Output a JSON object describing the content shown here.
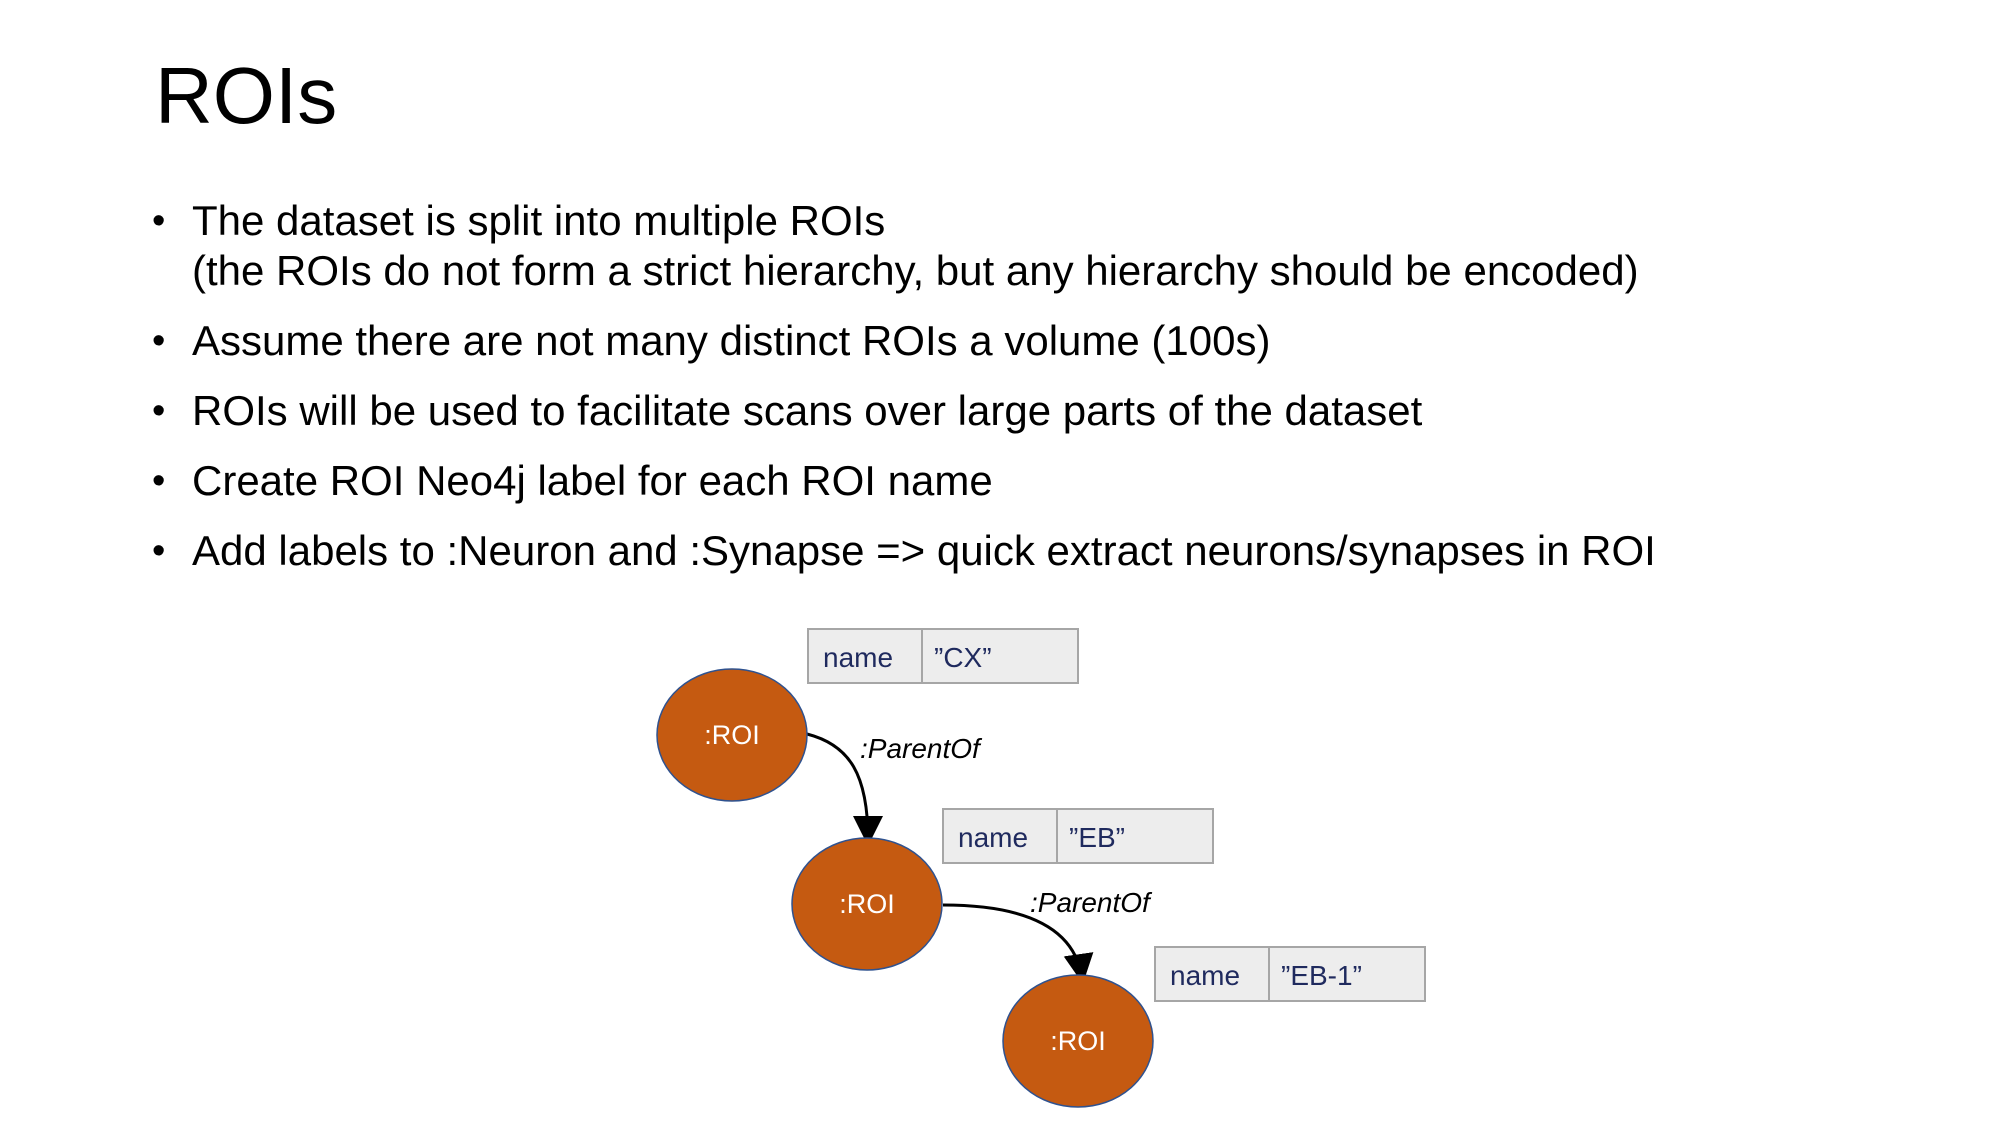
{
  "slide": {
    "title": "ROIs",
    "bullets": [
      {
        "lines": [
          "The dataset is split into multiple ROIs",
          "(the ROIs do not form a strict hierarchy, but any hierarchy should be encoded)"
        ]
      },
      {
        "lines": [
          "Assume there are not many distinct ROIs a volume (100s)"
        ]
      },
      {
        "lines": [
          "ROIs will be used to facilitate scans over large parts of the dataset"
        ]
      },
      {
        "lines": [
          "Create ROI Neo4j label for each ROI name"
        ]
      },
      {
        "lines": [
          "Add labels to :Neuron and :Synapse => quick extract neurons/synapses in ROI"
        ]
      }
    ],
    "bullet_glyph": "•"
  },
  "diagram": {
    "nodes": [
      {
        "label": ":ROI",
        "property_key": "name",
        "property_value": "”CX”"
      },
      {
        "label": ":ROI",
        "property_key": "name",
        "property_value": "”EB”"
      },
      {
        "label": ":ROI",
        "property_key": "name",
        "property_value": "”EB-1”"
      }
    ],
    "edges": [
      {
        "from": 0,
        "to": 1,
        "label": ":ParentOf"
      },
      {
        "from": 1,
        "to": 2,
        "label": ":ParentOf"
      }
    ],
    "colors": {
      "node_fill": "#c55a11",
      "node_stroke": "#2f528f",
      "property_box_fill": "#ededed",
      "property_text": "#1f2a5e"
    }
  }
}
